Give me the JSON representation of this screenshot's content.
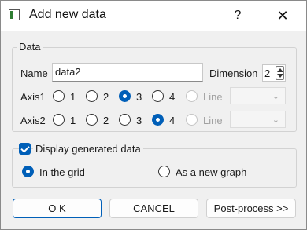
{
  "window": {
    "title": "Add new data",
    "help_label": "?",
    "close_label": "✕"
  },
  "data_group": {
    "title": "Data",
    "name_label": "Name",
    "name_value": "data2",
    "dimension_label": "Dimension",
    "dimension_value": "2",
    "axis1": {
      "label": "Axis1",
      "options": [
        "1",
        "2",
        "3",
        "4"
      ],
      "selected": "3",
      "line_label": "Line"
    },
    "axis2": {
      "label": "Axis2",
      "options": [
        "1",
        "2",
        "3",
        "4"
      ],
      "selected": "4",
      "line_label": "Line"
    }
  },
  "display_group": {
    "checkbox_label": "Display generated data",
    "checked": true,
    "option_grid": "In the grid",
    "option_graph": "As a new graph",
    "selected": "In the grid"
  },
  "buttons": {
    "ok": "O K",
    "cancel": "CANCEL",
    "postprocess": "Post-process >>"
  },
  "colors": {
    "accent": "#005fb8",
    "background": "#f0f0f0"
  }
}
